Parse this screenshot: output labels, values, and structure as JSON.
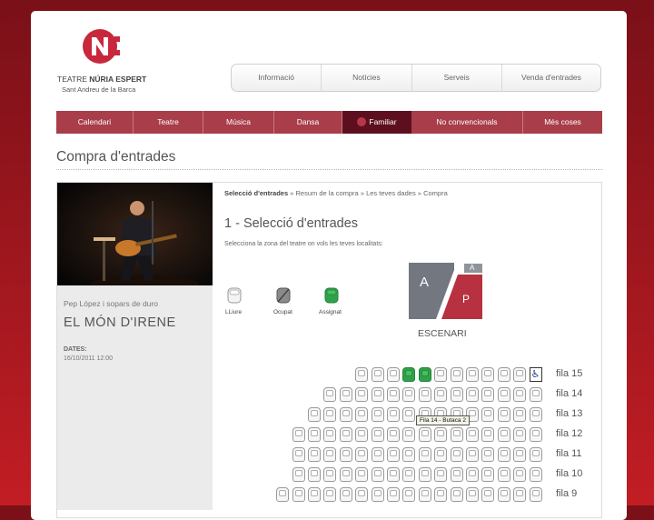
{
  "brand": {
    "name_light": "TEATRE ",
    "name_bold": "NÚRIA ESPERT",
    "location": "Sant Andreu de la Barca",
    "accent_color": "#c8283c"
  },
  "top_nav": [
    "Informació",
    "Notícies",
    "Serveis",
    "Venda d'entrades"
  ],
  "menu": [
    {
      "label": "Calendari",
      "active": false
    },
    {
      "label": "Teatre",
      "active": false
    },
    {
      "label": "Música",
      "active": false
    },
    {
      "label": "Dansa",
      "active": false
    },
    {
      "label": "Familiar",
      "active": true
    },
    {
      "label": "No convencionals",
      "active": false
    },
    {
      "label": "Més coses",
      "active": false
    }
  ],
  "page_title": "Compra d'entrades",
  "event": {
    "artist": "Pep López i sopars de duro",
    "title": "EL MÓN D'IRENE",
    "dates_label": "DATES:",
    "dates_value": "16/10/2011 12:00"
  },
  "breadcrumb": {
    "current": "Selecció d'entrades",
    "sep": "»",
    "steps": [
      "Resum de la compra",
      "Les teves dades",
      "Compra"
    ]
  },
  "step": {
    "title": "1 - Selecció d'entrades",
    "description": "Selecciona la zona del teatre on vols les teves localitats:"
  },
  "legend": [
    {
      "key": "lliure",
      "label": "LLiure"
    },
    {
      "key": "ocupat",
      "label": "Ocupat"
    },
    {
      "key": "assignat",
      "label": "Assignat"
    }
  ],
  "zones": {
    "a": "A",
    "p": "P",
    "a_small": "A",
    "stage": "ESCENARI"
  },
  "seat_rows": [
    {
      "label": "fila 15",
      "count": 11,
      "assigned": [
        3,
        4
      ],
      "wheelchair": true
    },
    {
      "label": "fila 14",
      "count": 14,
      "assigned": [],
      "wheelchair": false
    },
    {
      "label": "fila 13",
      "count": 15,
      "assigned": [],
      "wheelchair": false
    },
    {
      "label": "fila 12",
      "count": 16,
      "assigned": [],
      "wheelchair": false
    },
    {
      "label": "fila 11",
      "count": 16,
      "assigned": [],
      "wheelchair": false
    },
    {
      "label": "fila 10",
      "count": 16,
      "assigned": [],
      "wheelchair": false
    },
    {
      "label": "fila 9",
      "count": 17,
      "assigned": [],
      "wheelchair": false
    }
  ],
  "tooltip": "Fila 14 - Butaca 2",
  "colors": {
    "menu_bg": "#a93d4a",
    "menu_active": "#5e0f1f",
    "assigned": "#2fa14a",
    "zone_a": "#727780",
    "zone_p": "#b73140"
  }
}
